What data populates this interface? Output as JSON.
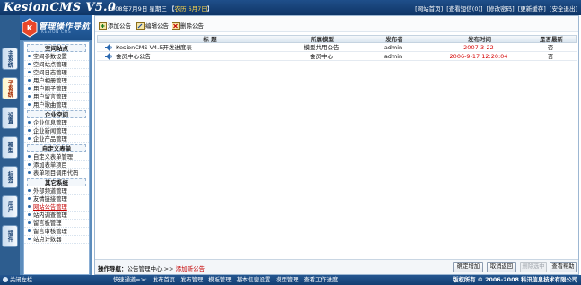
{
  "header": {
    "brand": "KesionCMS V5.0",
    "date_prefix": "2008年7月9日 星期三 【",
    "date_lunar": "农历 6月7日",
    "date_suffix": "】",
    "links": [
      "[网站首页]",
      "[查看短信(0)]",
      "[修改密码]",
      "[更新缓存]",
      "[安全退出]"
    ]
  },
  "vertical_tabs": [
    "主系统",
    "子系统",
    "设置",
    "模型",
    "标签",
    "用户",
    "插件"
  ],
  "sidebar": {
    "logo_text": "管理操作导航",
    "logo_sub": "KESION CMS",
    "groups": [
      {
        "title": "空间站点",
        "items": [
          "空间参数设置",
          "空间站点管理",
          "空间日志管理",
          "用户相册管理",
          "用户圈子管理",
          "用户留言管理",
          "用户歌曲管理"
        ]
      },
      {
        "title": "企业空间",
        "items": [
          "企业信息管理",
          "企业新闻管理",
          "企业产品管理"
        ]
      },
      {
        "title": "自定义表单",
        "items": [
          "自定义表单管理",
          "添加表单项目",
          "表单项目调用代码"
        ]
      },
      {
        "title": "其它系统",
        "items": [
          "外部频道管理",
          "友情链接管理",
          "网站公告管理",
          "站内调查管理",
          "留言板管理",
          "留言审核管理",
          "站点计数器"
        ]
      }
    ],
    "selected_item": "网站公告管理"
  },
  "toolbar": {
    "add": "添加公告",
    "edit": "编辑公告",
    "delete": "删除公告"
  },
  "grid": {
    "headers": {
      "title": "标 题",
      "model": "所属模型",
      "author": "发布者",
      "time": "发布时间",
      "latest": "是否最新"
    },
    "rows": [
      {
        "title": "KesionCMS V4.5开发进度表",
        "model": "模型共用公告",
        "author": "admin",
        "time": "2007-3-22",
        "latest": "否"
      },
      {
        "title": "会员中心公告",
        "model": "会员中心",
        "author": "admin",
        "time": "2006-9-17 12:20:04",
        "latest": "否"
      }
    ]
  },
  "bottombar": {
    "nav_label": "操作导航：",
    "nav_path": "公告管理中心",
    "nav_sep": ">>",
    "nav_current": "添加新公告",
    "buttons": {
      "confirm_add": "确定增加",
      "cancel_back": "取消返回",
      "delete_selected": "删除选中",
      "view_help": "查看帮助"
    }
  },
  "footer": {
    "close_label": "关闭左栏",
    "quick_label": "快速通道=>:",
    "quick_links": [
      "发布首页",
      "发布管理",
      "模板管理",
      "基本信息设置",
      "模型管理",
      "查看工作进度"
    ],
    "copyright": "版权所有 © 2006-2008  科汛信息技术有限公司"
  },
  "colors": {
    "header_blue": "#1f4f8a",
    "sidebar_blue": "#5c8cbc",
    "accent_red": "#d40000"
  }
}
